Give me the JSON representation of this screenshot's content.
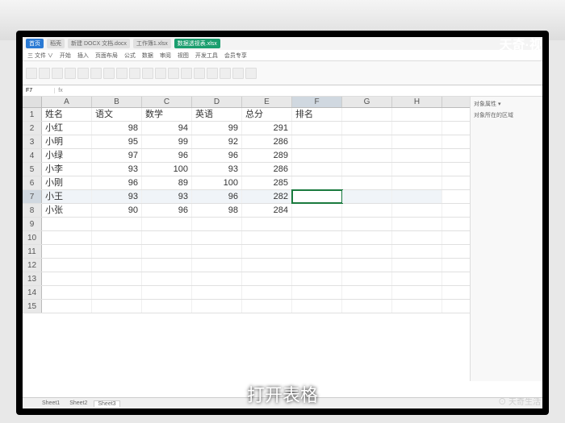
{
  "watermark_top": "天奇·视",
  "caption": "打开表格",
  "watermark_bottom": "⊙ 天奇生活",
  "tabs": {
    "t1": "首页",
    "t2": "稻壳",
    "t3": "新建 DOCX 文档.docx",
    "t4": "工作簿1.xlsx",
    "t5": "数据透视表.xlsx"
  },
  "ribbon_tabs": {
    "r1": "三 文件 ∨",
    "r2": "开始",
    "r3": "插入",
    "r4": "页面布局",
    "r5": "公式",
    "r6": "数据",
    "r7": "审阅",
    "r8": "视图",
    "r9": "开发工具",
    "r10": "会员专享"
  },
  "namebox": "F7",
  "sidepanel": {
    "title": "对象属性 ▾",
    "sub": "对象所在的区域"
  },
  "columns": {
    "A": "A",
    "B": "B",
    "C": "C",
    "D": "D",
    "E": "E",
    "F": "F",
    "G": "G",
    "H": "H"
  },
  "chart_data": {
    "type": "table",
    "headers": {
      "A": "姓名",
      "B": "语文",
      "C": "数学",
      "D": "英语",
      "E": "总分",
      "F": "排名"
    },
    "rows": [
      {
        "A": "小红",
        "B": 98,
        "C": 94,
        "D": 99,
        "E": 291
      },
      {
        "A": "小明",
        "B": 95,
        "C": 99,
        "D": 92,
        "E": 286
      },
      {
        "A": "小绿",
        "B": 97,
        "C": 96,
        "D": 96,
        "E": 289
      },
      {
        "A": "小李",
        "B": 93,
        "C": 100,
        "D": 93,
        "E": 286
      },
      {
        "A": "小刚",
        "B": 96,
        "C": 89,
        "D": 100,
        "E": 285
      },
      {
        "A": "小王",
        "B": 93,
        "C": 93,
        "D": 96,
        "E": 282
      },
      {
        "A": "小张",
        "B": 90,
        "C": 96,
        "D": 98,
        "E": 284
      }
    ]
  },
  "row_numbers": [
    "1",
    "2",
    "3",
    "4",
    "5",
    "6",
    "7",
    "8",
    "9",
    "10",
    "11",
    "12",
    "13",
    "14",
    "15"
  ],
  "sheets": {
    "s1": "Sheet1",
    "s2": "Sheet2",
    "s3": "Sheet3"
  }
}
